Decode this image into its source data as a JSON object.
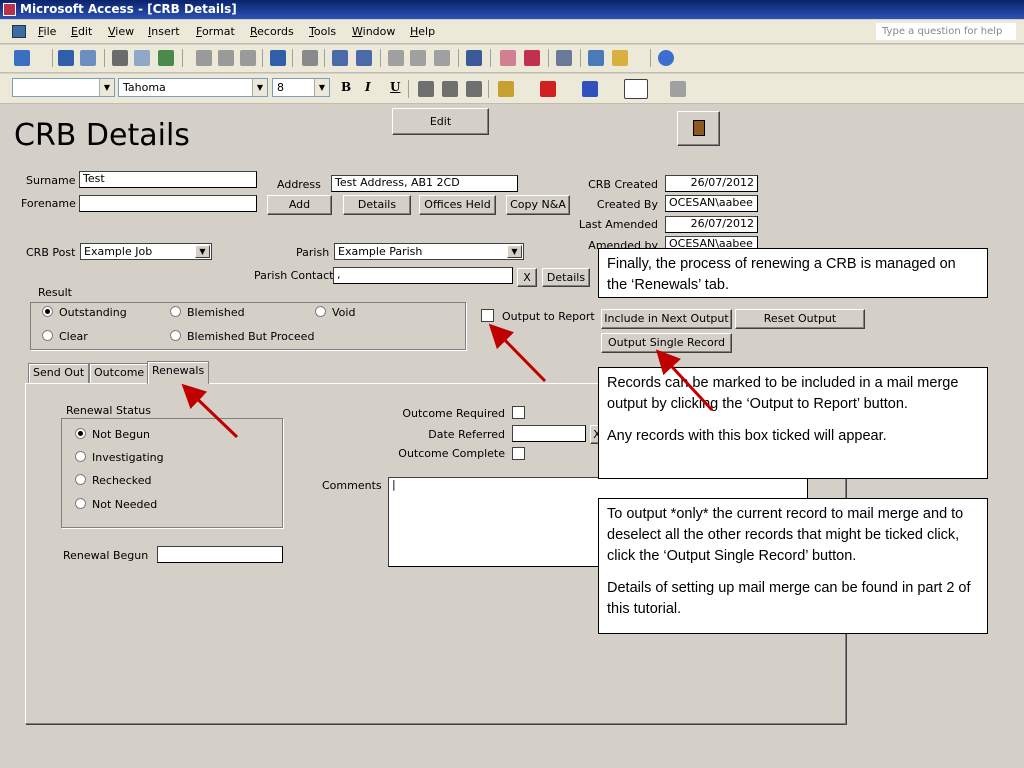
{
  "window": {
    "title": "Microsoft Access - [CRB Details]"
  },
  "menu": {
    "items": [
      "File",
      "Edit",
      "View",
      "Insert",
      "Format",
      "Records",
      "Tools",
      "Window",
      "Help"
    ],
    "help_placeholder": "Type a question for help"
  },
  "toolbar2": {
    "font": "Tahoma",
    "size": "8",
    "bold": "B",
    "italic": "I",
    "underline": "U"
  },
  "form": {
    "title": "CRB Details",
    "edit_button": "Edit",
    "exit_icon": "exit-door-icon",
    "surname_label": "Surname",
    "surname_value": "Test",
    "forename_label": "Forename",
    "forename_value": "",
    "address_label": "Address",
    "address_value": "Test Address, AB1 2CD",
    "add_button": "Add",
    "details_button": "Details",
    "offices_button": "Offices Held",
    "copy_button": "Copy N&A",
    "crb_created_label": "CRB Created",
    "crb_created_value": "26/07/2012",
    "created_by_label": "Created By",
    "created_by_value": "OCESAN\\aabee",
    "last_amended_label": "Last Amended",
    "last_amended_value": "26/07/2012",
    "amended_by_label": "Amended by",
    "amended_by_value": "OCESAN\\aabee",
    "crb_post_label": "CRB Post",
    "crb_post_value": "Example Job",
    "parish_label": "Parish",
    "parish_value": "Example Parish",
    "parish_contact_label": "Parish Contact",
    "parish_contact_value": ",",
    "x_button": "X",
    "contact_details_button": "Details",
    "result_label": "Result",
    "result_options": [
      "Outstanding",
      "Blemished",
      "Void",
      "Clear",
      "Blemished But Proceed"
    ],
    "output_to_report_label": "Output to Report",
    "include_button": "Include in Next Output",
    "reset_button": "Reset Output",
    "single_button": "Output Single Record"
  },
  "tabs": [
    "Send Out",
    "Outcome",
    "Renewals"
  ],
  "renewals": {
    "status_label": "Renewal Status",
    "status_options": [
      "Not Begun",
      "Investigating",
      "Rechecked",
      "Not Needed"
    ],
    "renewal_begun_label": "Renewal Begun",
    "outcome_required_label": "Outcome Required",
    "date_referred_label": "Date Referred",
    "outcome_complete_label": "Outcome Complete",
    "comments_label": "Comments",
    "x_button": "X"
  },
  "callouts": {
    "renewals": "Finally, the process of renewing a CRB is managed on the ‘Renewals’ tab.",
    "output_p1": "Records can be marked to be included in a mail merge output by clicking the ‘Output to Report’ button.",
    "output_p2": "Any records with this box ticked will appear.",
    "single_p1": "To output *only* the current record to mail merge and to deselect all the other records that might be ticked click, click the ‘Output Single Record’ button.",
    "single_p2": "Details of setting up mail merge can be found in part 2 of this tutorial."
  }
}
